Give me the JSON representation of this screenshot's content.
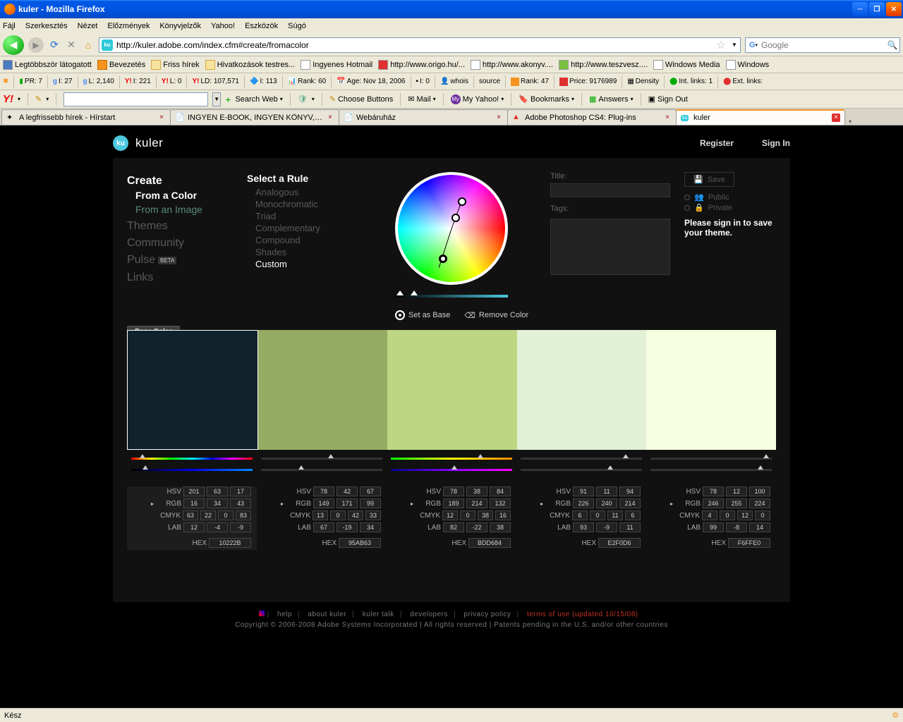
{
  "window": {
    "title": "kuler - Mozilla Firefox"
  },
  "menu": [
    "Fájl",
    "Szerkesztés",
    "Nézet",
    "Előzmények",
    "Könyvjelzők",
    "Yahoo!",
    "Eszközök",
    "Súgó"
  ],
  "addressbar": {
    "url": "http://kuler.adobe.com/index.cfm#create/fromacolor"
  },
  "searchbox": {
    "placeholder": "Google"
  },
  "bookmarks": [
    "Legtöbbször látogatott",
    "Bevezetés",
    "Friss hírek",
    "Hivatkozások testres...",
    "Ingyenes Hotmail",
    "http://www.origo.hu/...",
    "http://www.akonyv....",
    "http://www.teszvesz....",
    "Windows Media",
    "Windows"
  ],
  "seo": {
    "pr": "PR: 7",
    "gi": "I: 27",
    "gl": "L: 2,140",
    "yi": "I: 221",
    "yl": "L: 0",
    "yld": "LD: 107,571",
    "mi": "I: 113",
    "rank": "Rank: 60",
    "age": "Age: Nov 18, 2006",
    "ti": "I: 0",
    "whois": "whois",
    "source": "source",
    "rank2": "Rank: 47",
    "price": "Price: 9176989",
    "density": "Density",
    "intlinks": "Int. links: 1",
    "extlinks": "Ext. links:"
  },
  "yahoo": {
    "search": "Search Web",
    "choose": "Choose Buttons",
    "mail": "Mail",
    "my": "My Yahoo!",
    "bookmarks": "Bookmarks",
    "answers": "Answers",
    "signout": "Sign Out"
  },
  "tabs": [
    {
      "label": "A legfrissebb hírek - Hírstart",
      "active": false
    },
    {
      "label": "INGYEN E-BOOK, INGYEN KÖNYV, SZA...",
      "active": false
    },
    {
      "label": "Webáruház",
      "active": false
    },
    {
      "label": "Adobe Photoshop CS4: Plug-ins",
      "active": false
    },
    {
      "label": "kuler",
      "active": true
    }
  ],
  "kuler": {
    "brand": "kuler",
    "auth": {
      "register": "Register",
      "signin": "Sign In"
    },
    "nav": {
      "create": "Create",
      "fromcolor": "From a Color",
      "fromimage": "From an Image",
      "themes": "Themes",
      "community": "Community",
      "pulse": "Pulse",
      "beta": "BETA",
      "links": "Links"
    },
    "rules": {
      "heading": "Select a Rule",
      "items": [
        "Analogous",
        "Monochromatic",
        "Triad",
        "Complementary",
        "Compound",
        "Shades",
        "Custom"
      ],
      "active": "Custom"
    },
    "save": {
      "title_lbl": "Title:",
      "tags_lbl": "Tags:",
      "save_btn": "Save",
      "public": "Public",
      "private": "Private",
      "signin_msg": "Please sign in to save your theme."
    },
    "controls": {
      "base": "Base Color",
      "setbase": "Set as Base",
      "remove": "Remove Color"
    },
    "swatches": [
      {
        "hex": "10222B",
        "hsv": [
          201,
          63,
          17
        ],
        "rgb": [
          16,
          34,
          43
        ],
        "cmyk": [
          63,
          22,
          0,
          83
        ],
        "lab": [
          12,
          -4,
          -9
        ]
      },
      {
        "hex": "95AB63",
        "hsv": [
          78,
          42,
          67
        ],
        "rgb": [
          149,
          171,
          99
        ],
        "cmyk": [
          13,
          0,
          42,
          33
        ],
        "lab": [
          67,
          -19,
          34
        ]
      },
      {
        "hex": "BDD684",
        "hsv": [
          78,
          38,
          84
        ],
        "rgb": [
          189,
          214,
          132
        ],
        "cmyk": [
          12,
          0,
          38,
          16
        ],
        "lab": [
          82,
          -22,
          38
        ]
      },
      {
        "hex": "E2F0D6",
        "hsv": [
          91,
          11,
          94
        ],
        "rgb": [
          226,
          240,
          214
        ],
        "cmyk": [
          6,
          0,
          11,
          6
        ],
        "lab": [
          93,
          -9,
          11
        ]
      },
      {
        "hex": "F6FFE0",
        "hsv": [
          78,
          12,
          100
        ],
        "rgb": [
          246,
          255,
          224
        ],
        "cmyk": [
          4,
          0,
          12,
          0
        ],
        "lab": [
          99,
          -8,
          14
        ]
      }
    ],
    "labels": {
      "hsv": "HSV",
      "rgb": "RGB",
      "cmyk": "CMYK",
      "lab": "LAB",
      "hex": "HEX"
    },
    "footer": {
      "links": [
        "help",
        "about kuler",
        "kuler talk",
        "developers",
        "privacy policy"
      ],
      "terms": "terms of use (updated 10/15/08)",
      "copyright": "Copyright © 2006-2008 Adobe Systems Incorporated | All rights reserved | Patents pending in the U.S. and/or other countries"
    }
  },
  "status": {
    "text": "Kész"
  }
}
